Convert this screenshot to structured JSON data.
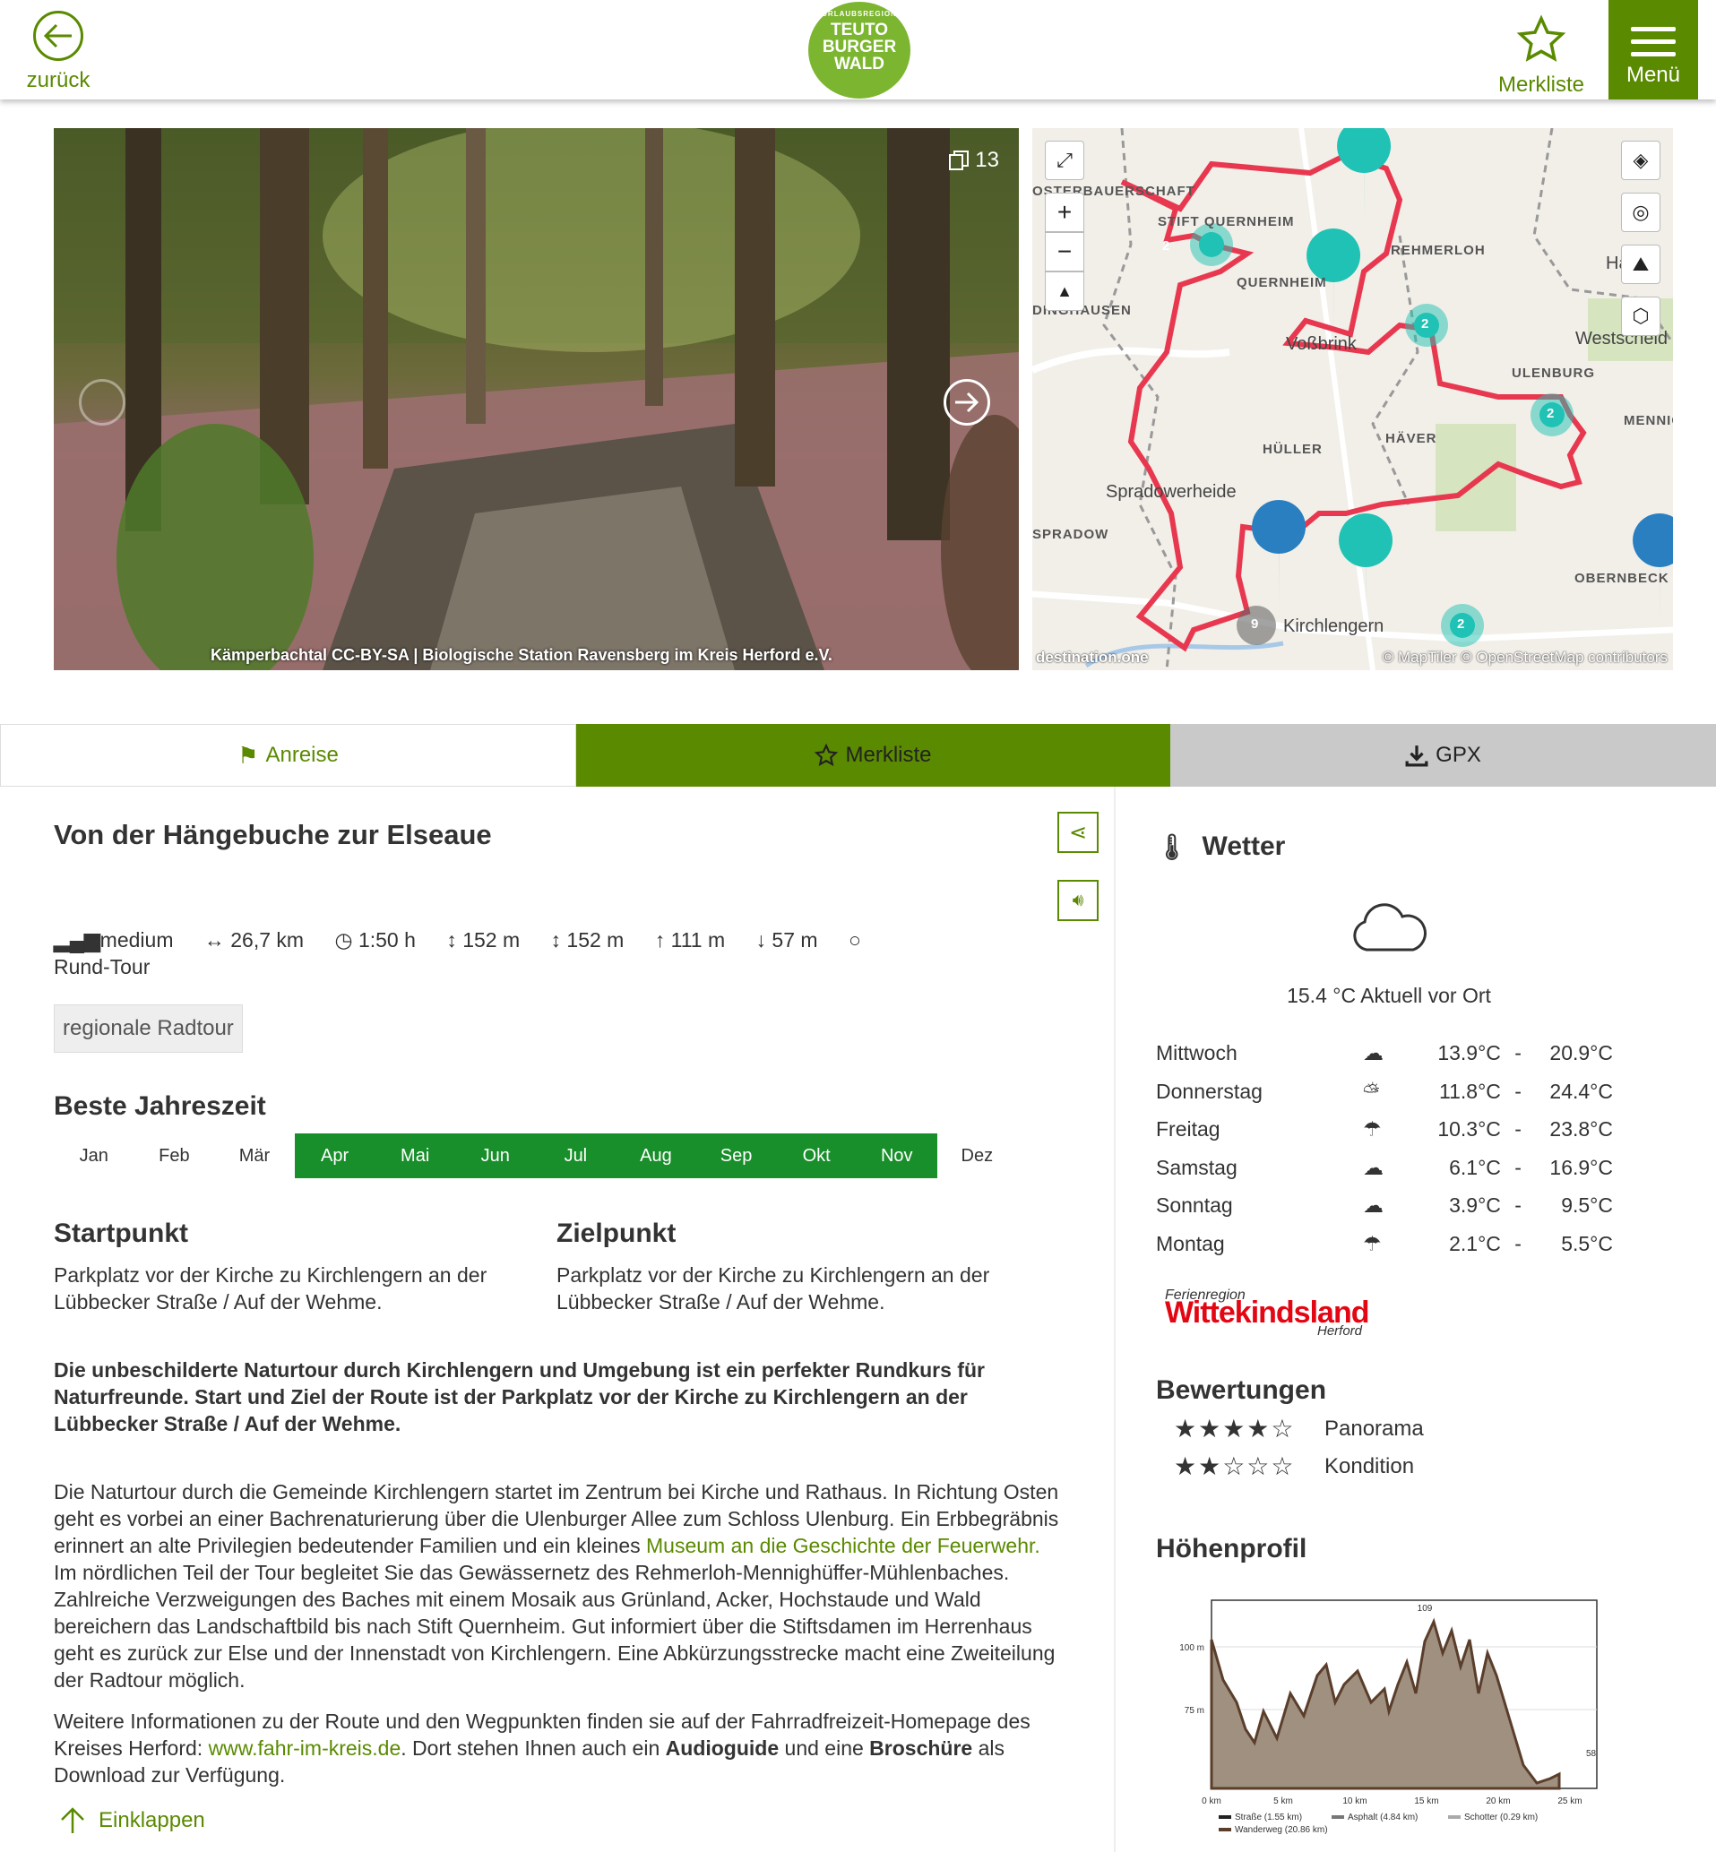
{
  "header": {
    "back_label": "zurück",
    "logo_line1": "URLAUBSREGION",
    "logo_line2": "TEUTO",
    "logo_line3": "BURGER",
    "logo_line4": "WALD",
    "merkliste_label": "Merkliste",
    "menu_label": "Menü"
  },
  "gallery": {
    "count": "13",
    "credit": "Kämperbachtal CC-BY-SA | Biologische Station Ravensberg im Kreis Herford e.V."
  },
  "map": {
    "labels": [
      "OSTERBAUERSCHAFT",
      "STIFT QUERNHEIM",
      "REHMERLOH",
      "QUERNHEIM",
      "DINGHAUSEN",
      "ULENBURG",
      "HÄVER",
      "HÜLLER",
      "SPRADOW",
      "OBERNBECK",
      "MENNIG"
    ],
    "places": [
      "Voßbrink",
      "Spradowerheide",
      "Westscheid",
      "Hagen",
      "Kirchlengern"
    ],
    "attribution": "© MapTiler © OpenStreetMap contributors",
    "brand": "destination.one",
    "clusters": [
      "2",
      "2",
      "2",
      "2",
      "9",
      "2"
    ]
  },
  "tabs": {
    "anreise": "Anreise",
    "merkliste": "Merkliste",
    "gpx": "GPX"
  },
  "tour": {
    "title": "Von der Hängebuche zur Elseaue",
    "difficulty": "medium",
    "distance": "26,7 km",
    "duration": "1:50 h",
    "ascent_total": "152 m",
    "descent_total": "152 m",
    "max_alt": "111 m",
    "min_alt": "57 m",
    "type": "Rund-Tour",
    "tag": "regionale Radtour",
    "season_title": "Beste Jahreszeit",
    "months": [
      "Jan",
      "Feb",
      "Mär",
      "Apr",
      "Mai",
      "Jun",
      "Jul",
      "Aug",
      "Sep",
      "Okt",
      "Nov",
      "Dez"
    ],
    "start_title": "Startpunkt",
    "start_text": "Parkplatz vor der Kirche zu Kirchlengern an der Lübbecker Straße / Auf der Wehme.",
    "end_title": "Zielpunkt",
    "end_text": "Parkplatz vor der Kirche zu Kirchlengern an der Lübbecker Straße / Auf der Wehme.",
    "intro": "Die unbeschilderte Naturtour durch Kirchlengern und Umgebung ist ein perfekter Rundkurs für Naturfreunde. Start und Ziel der Route ist der Parkplatz vor der Kirche zu Kirchlengern an der Lübbecker Straße / Auf der Wehme.",
    "body1_a": "Die Naturtour durch die Gemeinde Kirchlengern startet im Zentrum bei Kirche und Rathaus. In Richtung Osten geht es vorbei an einer Bachrenaturierung über die Ulenburger Allee zum Schloss Ulenburg. Ein Erbbegräbnis erinnert an alte Privilegien bedeutender Familien und ein kleines ",
    "body1_link": "Museum an die Geschichte der Feuerwehr.",
    "body1_b": " Im nördlichen Teil der Tour begleitet Sie das Gewässernetz des Rehmerloh-Mennighüffer-Mühlenbaches. Zahlreiche Verzweigungen des Baches mit einem Mosaik aus Grünland, Acker, Hochstaude und Wald bereichern das Landschaftbild bis nach Stift Quernheim. Gut informiert über die Stiftsdamen im Herrenhaus geht es zurück zur Else und der Innenstadt von Kirchlengern. Eine Abkürzungsstrecke macht eine Zweiteilung der Radtour möglich.",
    "body2_a": "Weitere Informationen zu der Route und den Wegpunkten finden sie auf der Fahrradfreizeit-Homepage des Kreises Herford: ",
    "body2_link": "www.fahr-im-kreis.de",
    "body2_b": ". Dort stehen Ihnen auch ein ",
    "body2_bold1": "Audioguide",
    "body2_c": " und eine ",
    "body2_bold2": "Broschüre",
    "body2_d": " als Download zur Verfügung.",
    "collapse": "Einklappen"
  },
  "weather": {
    "title": "Wetter",
    "current": "15.4 °C Aktuell vor Ort",
    "days": [
      {
        "day": "Mittwoch",
        "icon": "cloud-icon",
        "lo": "13.9°C",
        "hi": "20.9°C"
      },
      {
        "day": "Donnerstag",
        "icon": "sun-cloud-icon",
        "lo": "11.8°C",
        "hi": "24.4°C"
      },
      {
        "day": "Freitag",
        "icon": "sun-rain-icon",
        "lo": "10.3°C",
        "hi": "23.8°C"
      },
      {
        "day": "Samstag",
        "icon": "cloud-icon",
        "lo": "6.1°C",
        "hi": "16.9°C"
      },
      {
        "day": "Sonntag",
        "icon": "cloud-icon",
        "lo": "3.9°C",
        "hi": "9.5°C"
      },
      {
        "day": "Montag",
        "icon": "rain-icon",
        "lo": "2.1°C",
        "hi": "5.5°C"
      }
    ],
    "sep": "-"
  },
  "partner": {
    "line1": "Ferienregion",
    "line2": "Wittekindsland",
    "line3": "Herford"
  },
  "ratings": {
    "title": "Bewertungen",
    "items": [
      {
        "label": "Panorama",
        "stars": 4
      },
      {
        "label": "Kondition",
        "stars": 2
      }
    ]
  },
  "elevation": {
    "title": "Höhenprofil",
    "y_ticks": [
      "100 m",
      "75 m"
    ],
    "x_ticks": [
      "0 km",
      "5 km",
      "10 km",
      "15 km",
      "20 km",
      "25 km"
    ],
    "max_label": "109",
    "end_label": "58",
    "legend": [
      "Straße (1.55 km)",
      "Asphalt (4.84 km)",
      "Schotter (0.29 km)",
      "Wanderweg (20.86 km)"
    ]
  }
}
